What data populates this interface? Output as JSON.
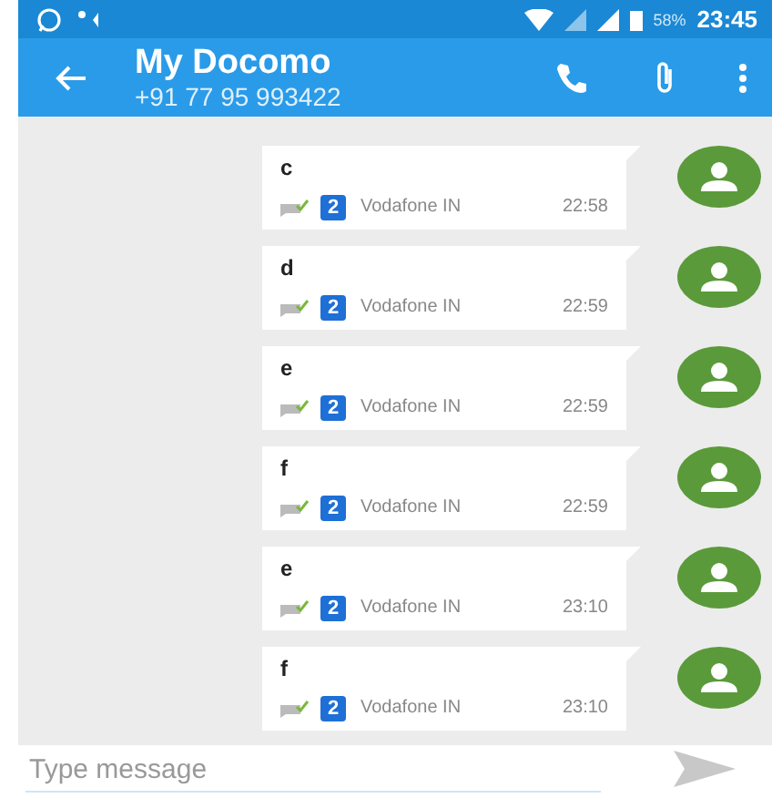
{
  "status_bar": {
    "battery": "58%",
    "time": "23:45"
  },
  "header": {
    "title": "My Docomo",
    "subtitle": "+91 77 95 993422"
  },
  "messages": [
    {
      "text": "c",
      "sim": "2",
      "carrier": "Vodafone IN",
      "time": "22:58"
    },
    {
      "text": "d",
      "sim": "2",
      "carrier": "Vodafone IN",
      "time": "22:59"
    },
    {
      "text": "e",
      "sim": "2",
      "carrier": "Vodafone IN",
      "time": "22:59"
    },
    {
      "text": "f",
      "sim": "2",
      "carrier": "Vodafone IN",
      "time": "22:59"
    },
    {
      "text": "e",
      "sim": "2",
      "carrier": "Vodafone IN",
      "time": "23:10"
    },
    {
      "text": "f",
      "sim": "2",
      "carrier": "Vodafone IN",
      "time": "23:10"
    }
  ],
  "composer": {
    "placeholder": "Type message"
  }
}
